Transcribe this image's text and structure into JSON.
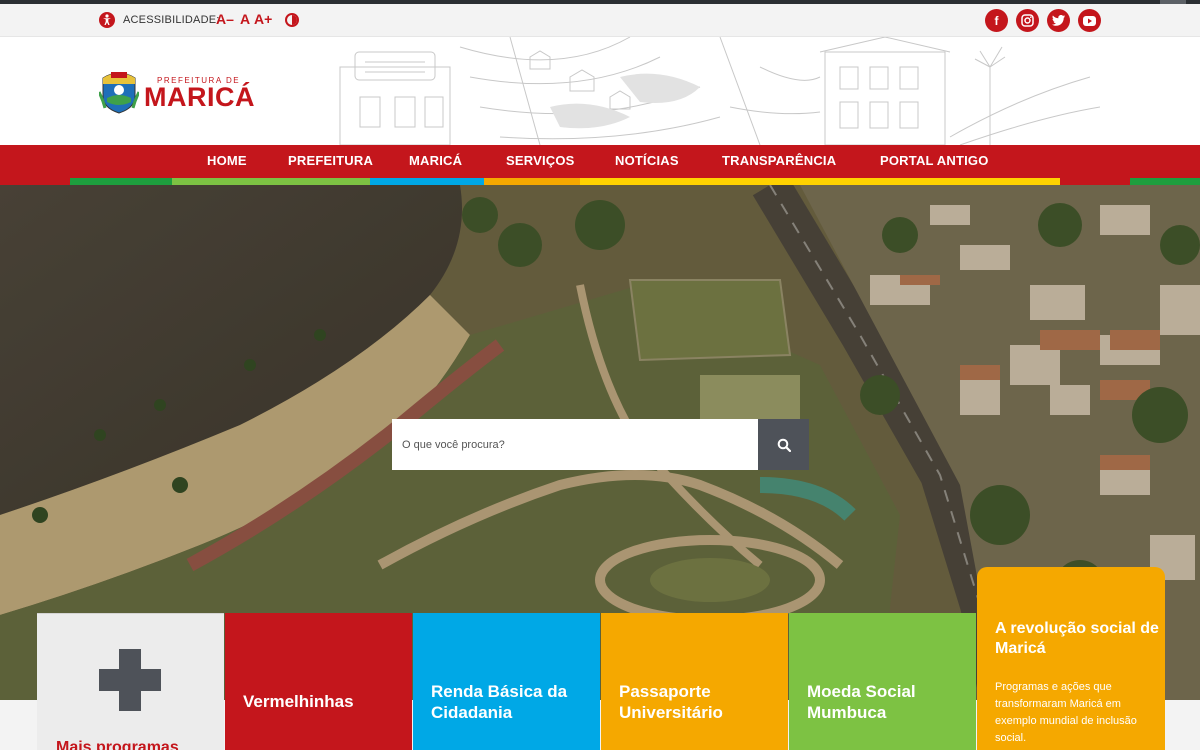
{
  "topbar": {
    "accessibility_label": "ACESSIBILIDADE:",
    "font_decrease": "A–",
    "font_normal": "A",
    "font_increase": "A+",
    "social": [
      "facebook",
      "instagram",
      "twitter",
      "youtube"
    ]
  },
  "logo": {
    "small_text": "PREFEITURA DE",
    "big_text": "MARICÁ"
  },
  "nav": {
    "items": [
      "HOME",
      "PREFEITURA",
      "MARICÁ",
      "SERVIÇOS",
      "NOTÍCIAS",
      "TRANSPARÊNCIA",
      "PORTAL ANTIGO"
    ]
  },
  "search": {
    "placeholder": "O que você procura?"
  },
  "cards": {
    "more_label": "Mais programas",
    "items": [
      {
        "title": "Vermelhinhas",
        "color": "#c4161c"
      },
      {
        "title": "Renda Básica da Cidadania",
        "color": "#00a8e6"
      },
      {
        "title": "Passaporte Universitário",
        "color": "#f5a800"
      },
      {
        "title": "Moeda Social Mumbuca",
        "color": "#7dc243"
      }
    ]
  },
  "revolution": {
    "title": "A revolução social de Maricá",
    "text": "Programas e ações que transformaram Maricá em exemplo mundial de inclusão social."
  },
  "colors": {
    "brand_red": "#c4161c",
    "stripe_green": "#1e9e3e",
    "stripe_light_green": "#7dc243",
    "stripe_blue": "#00a8e6",
    "stripe_orange": "#f5a800",
    "stripe_yellow": "#ffd200"
  }
}
